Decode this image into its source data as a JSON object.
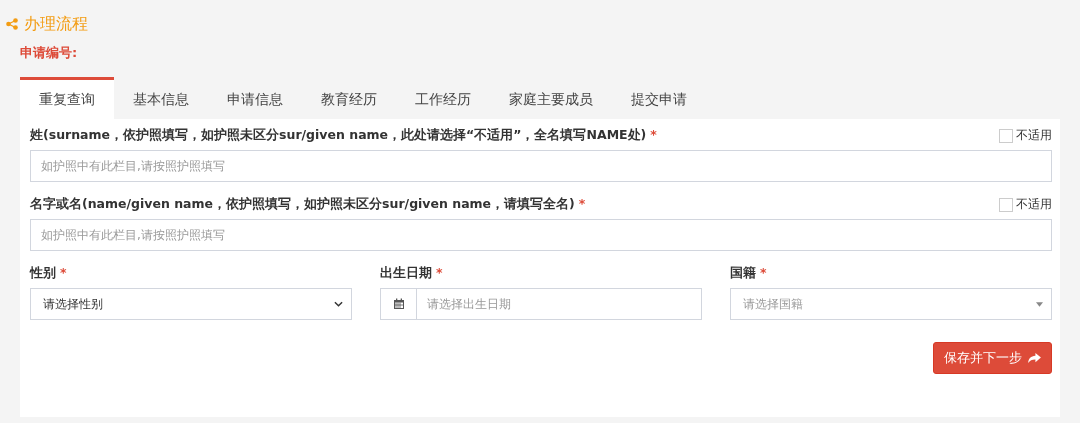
{
  "header": {
    "title": "办理流程",
    "application_number_label": "申请编号:"
  },
  "tabs": [
    {
      "label": "重复查询",
      "selected": true
    },
    {
      "label": "基本信息",
      "selected": false
    },
    {
      "label": "申请信息",
      "selected": false
    },
    {
      "label": "教育经历",
      "selected": false
    },
    {
      "label": "工作经历",
      "selected": false
    },
    {
      "label": "家庭主要成员",
      "selected": false
    },
    {
      "label": "提交申请",
      "selected": false
    }
  ],
  "name_fields": [
    {
      "label": "姓(surname，依护照填写，如护照未区分sur/given name，此处请选择“不适用”，全名填写NAME处)",
      "required_mark": "*",
      "not_applicable": {
        "label": "不适用",
        "checked": false
      },
      "placeholder": "如护照中有此栏目,请按照护照填写"
    },
    {
      "label": "名字或名(name/given name，依护照填写，如护照未区分sur/given name，请填写全名)",
      "required_mark": "*",
      "not_applicable": {
        "label": "不适用",
        "checked": false
      },
      "placeholder": "如护照中有此栏目,请按照护照填写"
    }
  ],
  "row_fields": [
    {
      "kind": "select",
      "label": "性别",
      "required_mark": "*",
      "value": "请选择性别"
    },
    {
      "kind": "date",
      "label": "出生日期",
      "required_mark": "*",
      "placeholder": "请选择出生日期"
    },
    {
      "kind": "combo",
      "label": "国籍",
      "required_mark": "*",
      "placeholder": "请选择国籍"
    }
  ],
  "submit_button": "保存并下一步"
}
